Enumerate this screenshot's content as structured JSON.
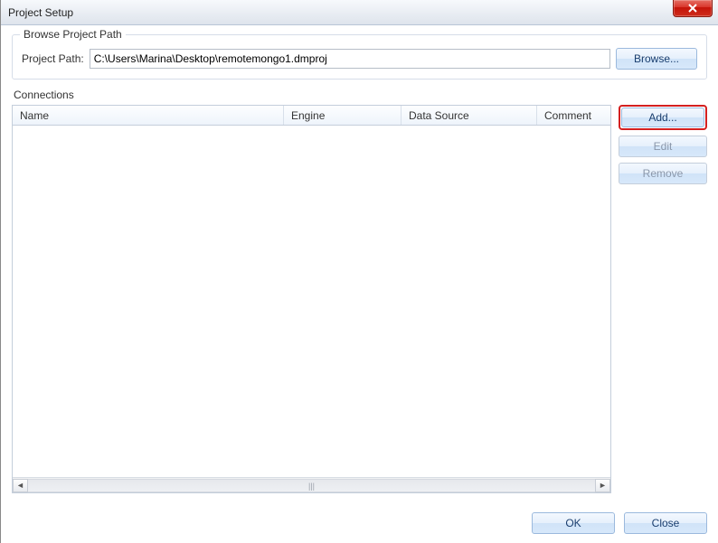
{
  "window": {
    "title": "Project Setup"
  },
  "browse": {
    "legend": "Browse Project Path",
    "label": "Project Path:",
    "value": "C:\\Users\\Marina\\Desktop\\remotemongo1.dmproj",
    "browse_btn": "Browse..."
  },
  "connections": {
    "label": "Connections",
    "columns": {
      "name": "Name",
      "engine": "Engine",
      "data_source": "Data Source",
      "comment": "Comment"
    },
    "buttons": {
      "add": "Add...",
      "edit": "Edit",
      "remove": "Remove"
    }
  },
  "footer": {
    "ok": "OK",
    "close": "Close"
  }
}
